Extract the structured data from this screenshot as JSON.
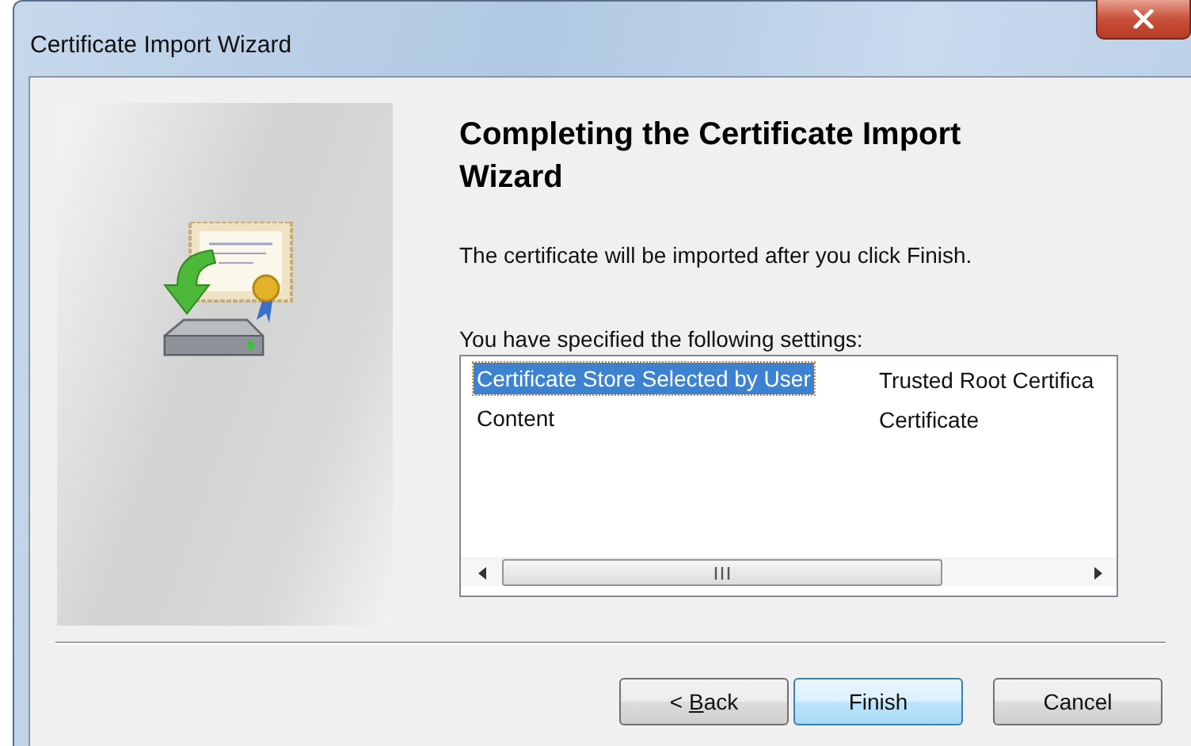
{
  "window": {
    "title": "Certificate Import Wizard"
  },
  "heading": "Completing the Certificate Import Wizard",
  "message": "The certificate will be imported after you click Finish.",
  "settings_label": "You have specified the following settings:",
  "settings": [
    {
      "setting": "Certificate Store Selected by User",
      "value": "Trusted Root Certifica",
      "selected": true
    },
    {
      "setting": "Content",
      "value": "Certificate",
      "selected": false
    }
  ],
  "buttons": [
    {
      "kind": "back",
      "before": "< ",
      "access_key": "B",
      "after": "ack",
      "default": false
    },
    {
      "kind": "finish",
      "before": "Finish",
      "default": true
    },
    {
      "kind": "cancel",
      "before": "Cancel",
      "default": false
    }
  ]
}
